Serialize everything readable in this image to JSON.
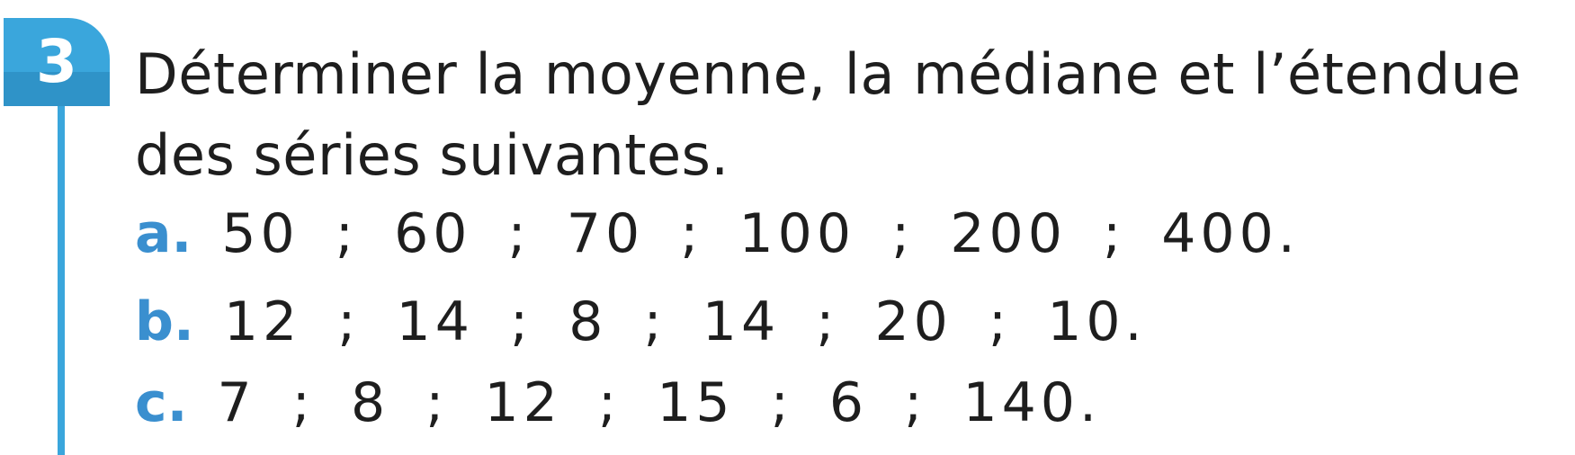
{
  "exercise": {
    "number": "3",
    "statement": "Déterminer la moyenne, la médiane et l’étendue des séries suivantes.",
    "series": [
      {
        "letter": "a.",
        "values": "50 ; 60 ; 70 ; 100 ; 200 ; 400."
      },
      {
        "letter": "b.",
        "values": "12 ; 14 ; 8 ; 14 ; 20 ; 10."
      },
      {
        "letter": "c.",
        "values": "7 ; 8 ; 12 ; 15 ; 6 ; 140."
      }
    ]
  },
  "colors": {
    "badge": "#3aa6dc",
    "letters": "#3a8fcf",
    "text": "#1e1e1e"
  }
}
